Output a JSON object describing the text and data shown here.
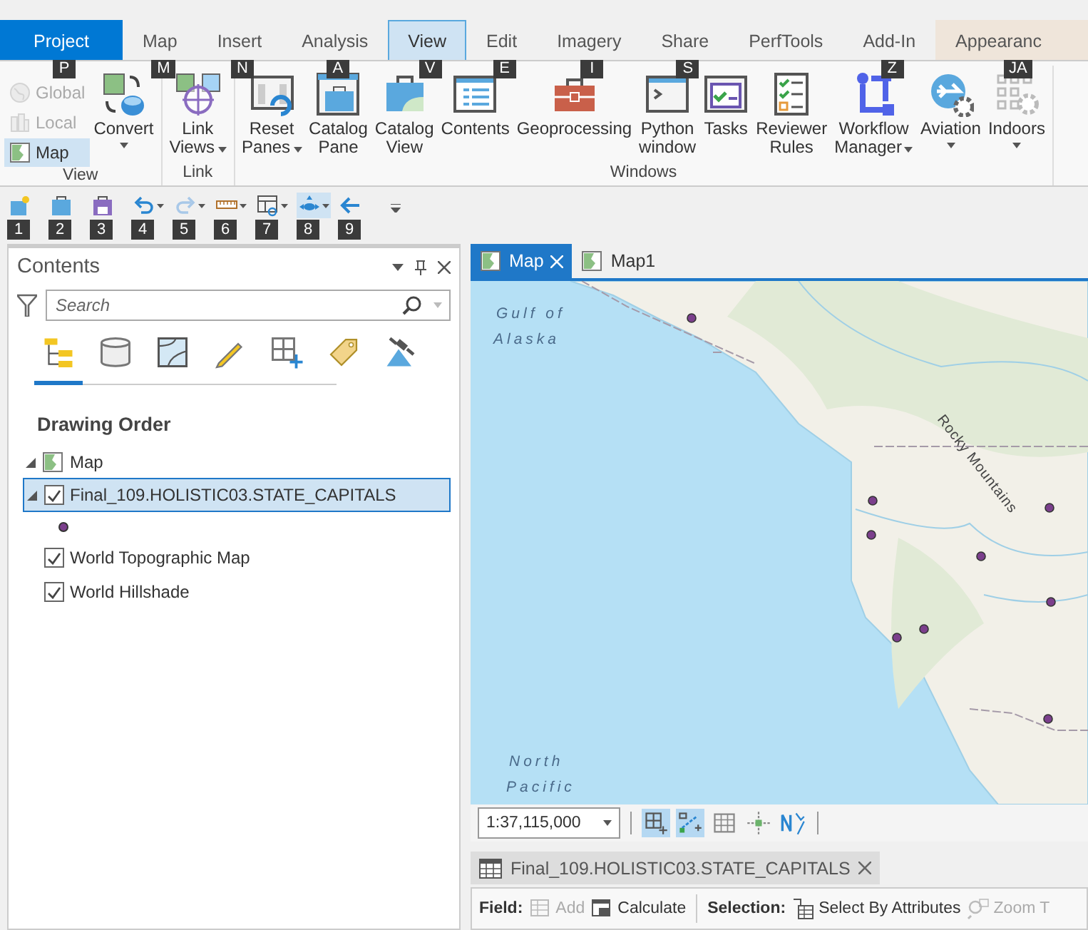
{
  "ribbon_tabs": [
    {
      "label": "Project",
      "keytip": "P",
      "selected": false,
      "kind": "backstage"
    },
    {
      "label": "Map",
      "keytip": "M",
      "selected": false,
      "kind": "tab"
    },
    {
      "label": "Insert",
      "keytip": "N",
      "selected": false,
      "kind": "tab"
    },
    {
      "label": "Analysis",
      "keytip": "A",
      "selected": false,
      "kind": "tab"
    },
    {
      "label": "View",
      "keytip": "V",
      "selected": true,
      "kind": "tab"
    },
    {
      "label": "Edit",
      "keytip": "E",
      "selected": false,
      "kind": "tab"
    },
    {
      "label": "Imagery",
      "keytip": "I",
      "selected": false,
      "kind": "tab"
    },
    {
      "label": "Share",
      "keytip": "S",
      "selected": false,
      "kind": "tab"
    },
    {
      "label": "PerfTools",
      "selected": false,
      "kind": "tab"
    },
    {
      "label": "Add-In",
      "keytip": "Z",
      "selected": false,
      "kind": "tab"
    },
    {
      "label": "Appearanc",
      "keytip": "JA",
      "selected": false,
      "kind": "contextual"
    }
  ],
  "ribbon_groups": [
    {
      "title": "View",
      "buttons": [
        {
          "kind": "small",
          "lines": [
            "Global"
          ],
          "disabled": true,
          "selected": false
        },
        {
          "kind": "small",
          "lines": [
            "Local"
          ],
          "disabled": true,
          "selected": false
        },
        {
          "kind": "small",
          "lines": [
            "Map"
          ],
          "disabled": false,
          "selected": true
        },
        {
          "kind": "large",
          "lines": [
            "Convert"
          ],
          "dropdown": true
        }
      ]
    },
    {
      "title": "Link",
      "buttons": [
        {
          "kind": "large",
          "lines": [
            "Link",
            "Views"
          ],
          "dropdown": true
        }
      ]
    },
    {
      "title": "Windows",
      "buttons": [
        {
          "kind": "large",
          "lines": [
            "Reset",
            "Panes"
          ],
          "dropdown": true
        },
        {
          "kind": "large",
          "lines": [
            "Catalog",
            "Pane"
          ],
          "dropdown": false
        },
        {
          "kind": "large",
          "lines": [
            "Catalog",
            "View"
          ],
          "dropdown": false
        },
        {
          "kind": "large",
          "lines": [
            "Contents"
          ],
          "dropdown": false
        },
        {
          "kind": "large",
          "lines": [
            "Geoprocessing"
          ],
          "dropdown": false
        },
        {
          "kind": "large",
          "lines": [
            "Python",
            "window"
          ],
          "dropdown": false
        },
        {
          "kind": "large",
          "lines": [
            "Tasks"
          ],
          "dropdown": false
        },
        {
          "kind": "large",
          "lines": [
            "Reviewer",
            "Rules"
          ],
          "dropdown": false
        },
        {
          "kind": "large",
          "lines": [
            "Workflow",
            "Manager"
          ],
          "dropdown": true
        },
        {
          "kind": "large",
          "lines": [
            "Aviation"
          ],
          "dropdown": true
        },
        {
          "kind": "large",
          "lines": [
            "Indoors"
          ],
          "dropdown": true
        }
      ]
    }
  ],
  "quick_access": [
    {
      "keytip": "1",
      "dropdown": false,
      "selected": false
    },
    {
      "keytip": "2",
      "dropdown": false,
      "selected": false
    },
    {
      "keytip": "3",
      "dropdown": false,
      "selected": false
    },
    {
      "keytip": "4",
      "dropdown": true,
      "selected": false
    },
    {
      "keytip": "5",
      "dropdown": true,
      "selected": false
    },
    {
      "keytip": "6",
      "dropdown": true,
      "selected": false
    },
    {
      "keytip": "7",
      "dropdown": true,
      "selected": false
    },
    {
      "keytip": "8",
      "dropdown": true,
      "selected": true
    },
    {
      "keytip": "9",
      "dropdown": false,
      "selected": false
    }
  ],
  "contents": {
    "title": "Contents",
    "search": {
      "placeholder": "Search"
    },
    "view_tabs": [
      {
        "selected": true
      },
      {
        "selected": false
      },
      {
        "selected": false
      },
      {
        "selected": false
      },
      {
        "selected": false
      },
      {
        "selected": false
      },
      {
        "selected": false
      }
    ],
    "heading": "Drawing Order",
    "tree": [
      {
        "label": "Map",
        "kind": "map",
        "expanded": true,
        "selected": false,
        "children": [
          {
            "label": "Final_109.HOLISTIC03.STATE_CAPITALS",
            "kind": "layer",
            "checked": true,
            "expanded": true,
            "selected": true
          },
          {
            "label": "World Topographic Map",
            "kind": "layer",
            "checked": true,
            "selected": false
          },
          {
            "label": "World Hillshade",
            "kind": "layer",
            "checked": true,
            "selected": false
          }
        ]
      }
    ]
  },
  "map_tabs": [
    {
      "label": "Map",
      "selected": true
    },
    {
      "label": "Map1",
      "selected": false
    }
  ],
  "map": {
    "labels": [
      {
        "kind": "water",
        "lines": [
          "Gulf of",
          "Alaska"
        ]
      },
      {
        "kind": "range",
        "lines": [
          "Rocky Mountains"
        ]
      },
      {
        "kind": "water",
        "lines": [
          "North",
          "Pacific"
        ]
      }
    ]
  },
  "scale": "1:37,115,000",
  "map_tools": [
    {
      "selected": true
    },
    {
      "selected": true
    },
    {
      "selected": false
    },
    {
      "selected": false
    },
    {
      "selected": false
    }
  ],
  "table_tab": {
    "label": "Final_109.HOLISTIC03.STATE_CAPITALS"
  },
  "table_toolbar": [
    {
      "kind": "label",
      "text": "Field:"
    },
    {
      "kind": "button",
      "text": "Add",
      "disabled": true
    },
    {
      "kind": "button",
      "text": "Calculate",
      "disabled": false
    },
    {
      "kind": "separator"
    },
    {
      "kind": "label",
      "text": "Selection:"
    },
    {
      "kind": "button",
      "text": "Select By Attributes",
      "disabled": false
    },
    {
      "kind": "button",
      "text": "Zoom T",
      "disabled": true
    }
  ]
}
